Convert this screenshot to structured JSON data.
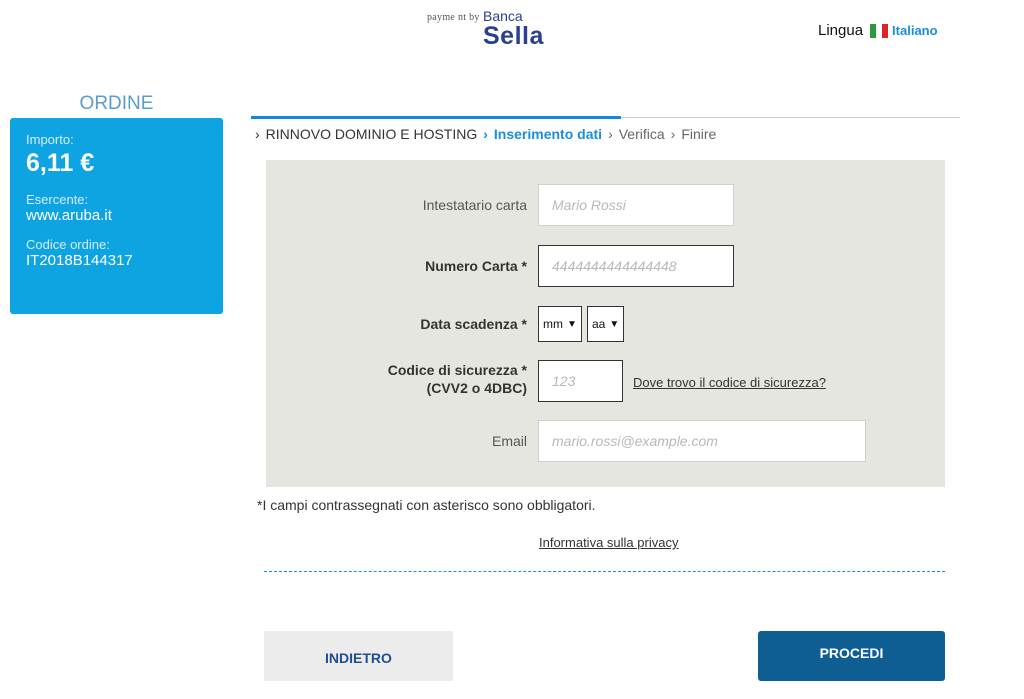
{
  "header": {
    "payment_by": "payme nt by",
    "brand_top": "Banca",
    "brand_main": "Sella",
    "language_label": "Lingua",
    "language_value": "Italiano"
  },
  "order": {
    "title": "ORDINE",
    "amount_label": "Importo:",
    "amount": "6,11 €",
    "merchant_label": "Esercente:",
    "merchant": "www.aruba.it",
    "order_code_label": "Codice ordine:",
    "order_code": "IT2018B144317"
  },
  "breadcrumb": {
    "step1": "RINNOVO DOMINIO E HOSTING",
    "step2": "Inserimento dati",
    "step3": "Verifica",
    "step4": "Finire"
  },
  "form": {
    "holder_label": "Intestatario carta",
    "holder_placeholder": "Mario Rossi",
    "card_label": "Numero Carta *",
    "card_placeholder": "4444444444444448",
    "expiry_label": "Data scadenza *",
    "month_value": "mm",
    "year_value": "aa",
    "cvv_label_line1": "Codice di sicurezza *",
    "cvv_label_line2": "(CVV2 o 4DBC)",
    "cvv_placeholder": "123",
    "cvv_help_link": "Dove trovo il codice di sicurezza?",
    "email_label": "Email",
    "email_placeholder": "mario.rossi@example.com"
  },
  "required_note": "*I campi contrassegnati con asterisco sono obbligatori.",
  "privacy_link": "Informativa sulla privacy",
  "buttons": {
    "back": "INDIETRO",
    "next": "PROCEDI"
  },
  "colors": {
    "accent": "#0ea4e2",
    "primary_button": "#0e5e93",
    "link_blue": "#1a8fd6",
    "panel_bg": "#e6e6e1"
  },
  "icons": {
    "flag": "italy-flag-icon",
    "breadcrumb_separator": "chevron-right-icon",
    "select_arrow": "chevron-down-icon"
  }
}
